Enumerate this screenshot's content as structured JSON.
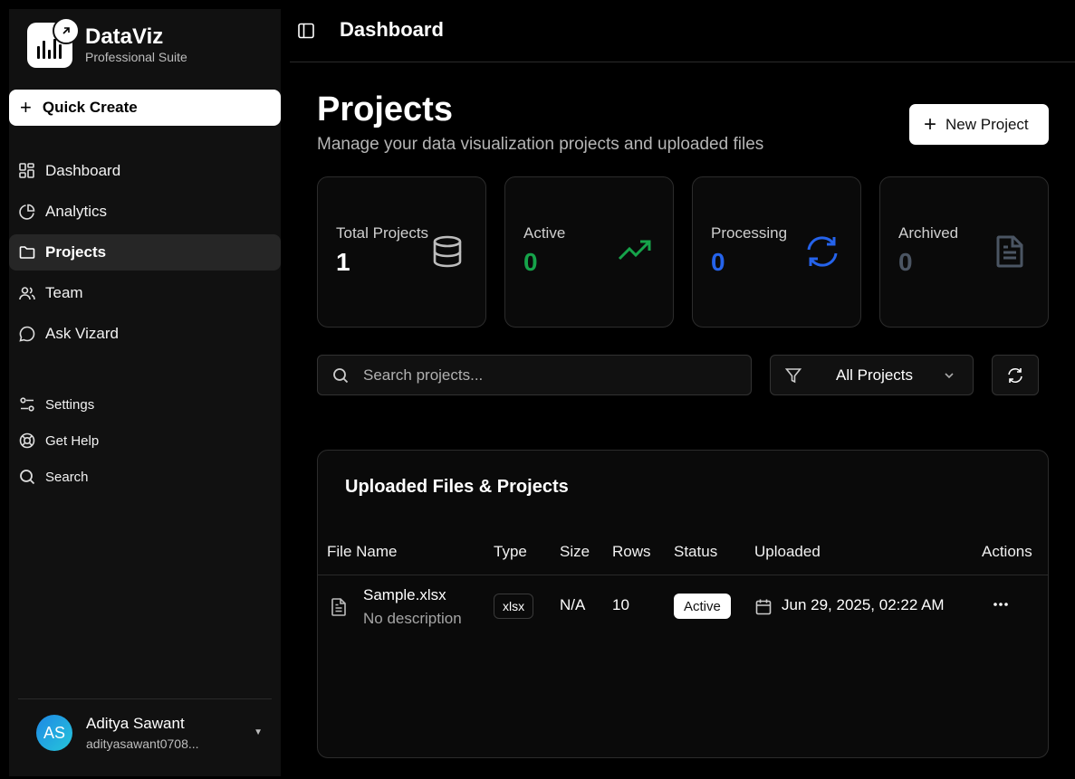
{
  "brand": {
    "name": "DataViz",
    "subtitle": "Professional Suite"
  },
  "quick_create": {
    "label": "Quick Create"
  },
  "nav": [
    {
      "label": "Dashboard",
      "icon": "dashboard-icon"
    },
    {
      "label": "Analytics",
      "icon": "pie-chart-icon"
    },
    {
      "label": "Projects",
      "icon": "folder-icon",
      "active": true
    },
    {
      "label": "Team",
      "icon": "users-icon"
    },
    {
      "label": "Ask Vizard",
      "icon": "chat-icon"
    }
  ],
  "nav_secondary": [
    {
      "label": "Settings",
      "icon": "settings-icon"
    },
    {
      "label": "Get Help",
      "icon": "help-icon"
    },
    {
      "label": "Search",
      "icon": "search-icon"
    }
  ],
  "user": {
    "initials": "AS",
    "name": "Aditya Sawant",
    "email": "adityasawant0708..."
  },
  "topbar": {
    "title": "Dashboard"
  },
  "page": {
    "title": "Projects",
    "subtitle": "Manage your data visualization projects and uploaded files",
    "new_project_label": "New Project"
  },
  "stats": [
    {
      "label": "Total Projects",
      "value": "1",
      "color": "#ffffff",
      "icon": "database-icon"
    },
    {
      "label": "Active",
      "value": "0",
      "color": "#16a34a",
      "icon": "trending-up-icon"
    },
    {
      "label": "Processing",
      "value": "0",
      "color": "#2563eb",
      "icon": "refresh-icon"
    },
    {
      "label": "Archived",
      "value": "0",
      "color": "#4b5563",
      "icon": "file-icon"
    }
  ],
  "search": {
    "placeholder": "Search projects..."
  },
  "filter": {
    "selected": "All Projects"
  },
  "table": {
    "title": "Uploaded Files & Projects",
    "columns": [
      "File Name",
      "Type",
      "Size",
      "Rows",
      "Status",
      "Uploaded",
      "Actions"
    ],
    "rows": [
      {
        "name": "Sample.xlsx",
        "description": "No description",
        "type": "xlsx",
        "size": "N/A",
        "rows": "10",
        "status": "Active",
        "uploaded": "Jun 29, 2025, 02:22 AM"
      }
    ]
  }
}
